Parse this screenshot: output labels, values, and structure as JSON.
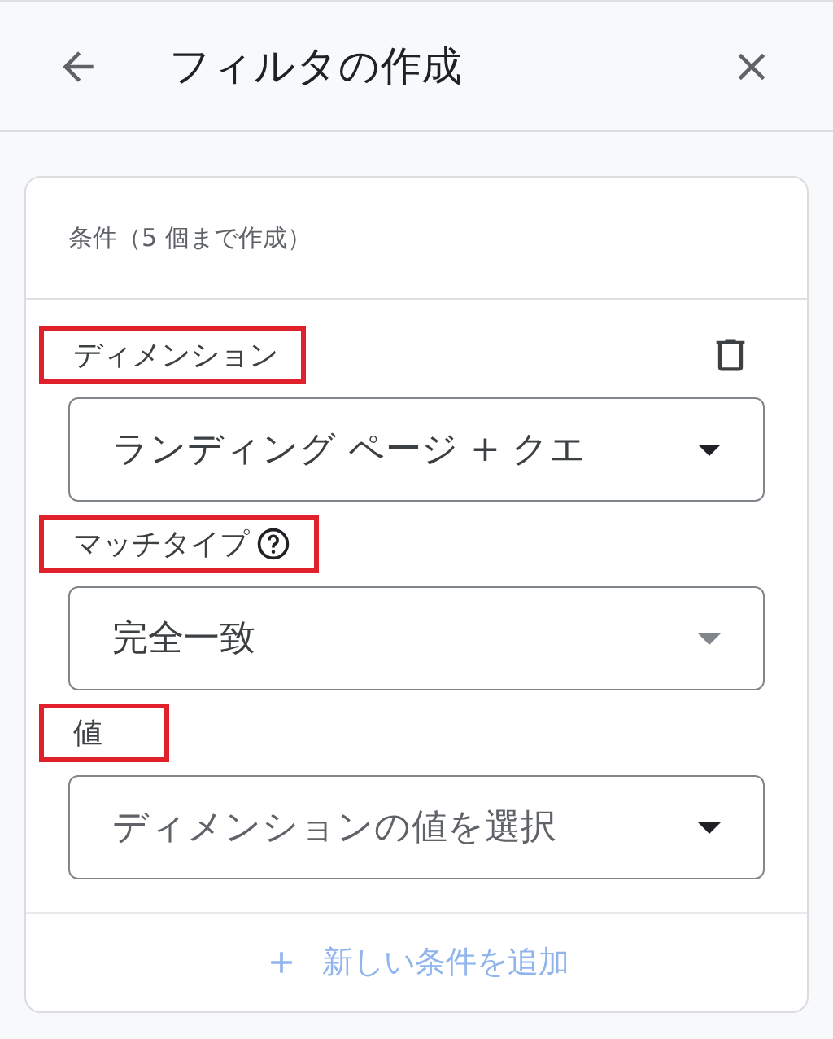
{
  "header": {
    "title": "フィルタの作成"
  },
  "card": {
    "heading": "条件（5 個まで作成）",
    "fields": [
      {
        "label": "ディメンション",
        "value": "ランディング ページ + クエ",
        "highlighted": true,
        "deletable": true,
        "help": false
      },
      {
        "label": "マッチタイプ",
        "value": "完全一致",
        "highlighted": true,
        "deletable": false,
        "help": true
      },
      {
        "label": "値",
        "placeholder": "ディメンションの値を選択",
        "highlighted": true,
        "deletable": false,
        "help": false
      }
    ],
    "add_button": {
      "label": "新しい条件を追加",
      "disabled": true
    }
  }
}
